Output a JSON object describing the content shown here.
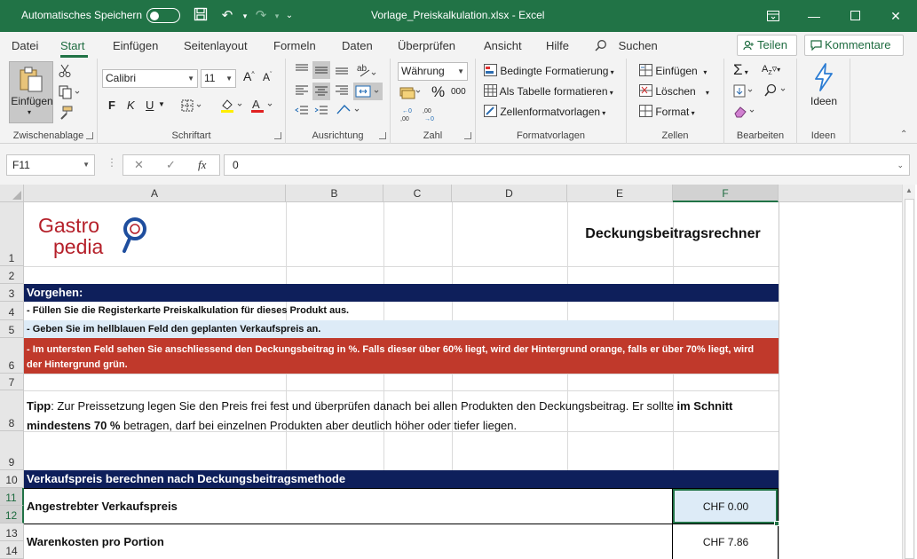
{
  "titlebar": {
    "autosave_label": "Automatisches Speichern",
    "filename": "Vorlage_Preiskalkulation.xlsx",
    "separator": "-",
    "app": "Excel"
  },
  "menu": {
    "tabs": [
      "Datei",
      "Start",
      "Einfügen",
      "Seitenlayout",
      "Formeln",
      "Daten",
      "Überprüfen",
      "Ansicht",
      "Hilfe"
    ],
    "search_label": "Suchen",
    "share_label": "Teilen",
    "comments_label": "Kommentare"
  },
  "ribbon": {
    "clipboard": {
      "paste_label": "Einfügen",
      "group_label": "Zwischenablage"
    },
    "font": {
      "font_name": "Calibri",
      "font_size": "11",
      "bold": "F",
      "italic": "K",
      "underline": "U",
      "group_label": "Schriftart"
    },
    "alignment": {
      "group_label": "Ausrichtung"
    },
    "number": {
      "format": "Währung",
      "percent": "%",
      "thousands": "000",
      "group_label": "Zahl"
    },
    "styles": {
      "conditional": "Bedingte Formatierung",
      "as_table": "Als Tabelle formatieren",
      "cell_styles": "Zellenformatvorlagen",
      "group_label": "Formatvorlagen"
    },
    "cells": {
      "insert": "Einfügen",
      "delete": "Löschen",
      "format": "Format",
      "group_label": "Zellen"
    },
    "editing": {
      "group_label": "Bearbeiten"
    },
    "ideas": {
      "label": "Ideen",
      "group_label": "Ideen"
    }
  },
  "formula_bar": {
    "name_box": "F11",
    "fx": "fx",
    "value": "0"
  },
  "columns": [
    "A",
    "B",
    "C",
    "D",
    "E",
    "F"
  ],
  "rows": [
    "1",
    "2",
    "3",
    "4",
    "5",
    "6",
    "7",
    "8",
    "9",
    "10",
    "11",
    "12",
    "13",
    "14"
  ],
  "sheet": {
    "logo_line1": "Gastro",
    "logo_line2": "pedia",
    "title": "Deckungsbeitragsrechner",
    "procedure_header": "Vorgehen:",
    "step1": "- Füllen Sie die Registerkarte Preiskalkulation für dieses Produkt aus.",
    "step2": "- Geben Sie im hellblauen Feld den geplanten Verkaufspreis an.",
    "step3": "- Im untersten Feld sehen Sie anschliessend den Deckungsbeitrag in %. Falls dieser über 60% liegt, wird der Hintergrund orange, falls er über 70% liegt, wird der Hintergrund grün.",
    "tip_label": "Tipp",
    "tip_part1": ": Zur Preissetzung legen Sie  den Preis frei fest und überprüfen danach bei allen Produkten den Deckungsbeitrag. Er sollte ",
    "tip_bold": "im Schnitt mindestens 70 %",
    "tip_part2": " betragen, darf bei einzelnen Produkten aber deutlich höher oder tiefer liegen.",
    "section_header": "Verkaufspreis berechnen nach Deckungsbeitragsmethode",
    "target_price_label": "Angestrebter Verkaufspreis",
    "target_price_value": "CHF 0.00",
    "cost_label": "Warenkosten pro Portion",
    "cost_value": "CHF 7.86"
  },
  "colors": {
    "excel_green": "#217346",
    "navy": "#0E1F5B",
    "red": "#C0392B",
    "light_blue": "#DDEBF7",
    "logo_red": "#B5202A",
    "logo_blue": "#1F4E9E"
  }
}
